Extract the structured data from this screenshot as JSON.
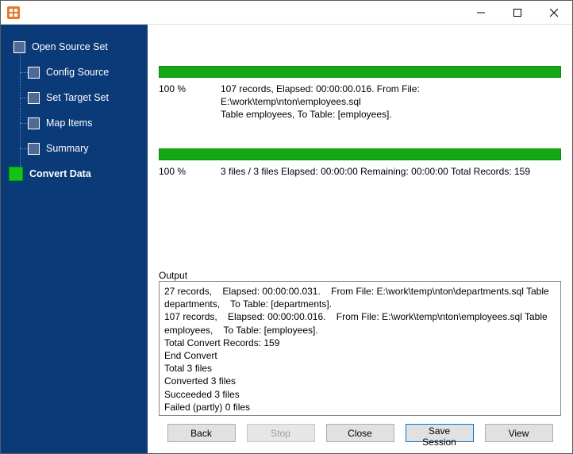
{
  "sidebar": {
    "root": "Open Source Set",
    "items": [
      "Config Source",
      "Set Target Set",
      "Map Items",
      "Summary"
    ],
    "active": "Convert Data"
  },
  "progress1": {
    "pct": "100 %",
    "line1": "107 records,    Elapsed: 00:00:00.016.    From File: E:\\work\\temp\\nton\\employees.sql",
    "line2": "Table employees,    To Table: [employees]."
  },
  "progress2": {
    "pct": "100 %",
    "line": "3 files / 3 files    Elapsed: 00:00:00    Remaining: 00:00:00    Total Records: 159"
  },
  "output_label": "Output",
  "output_text": "27 records,    Elapsed: 00:00:00.031.    From File: E:\\work\\temp\\nton\\departments.sql Table departments,    To Table: [departments].\n107 records,    Elapsed: 00:00:00.016.    From File: E:\\work\\temp\\nton\\employees.sql Table employees,    To Table: [employees].\nTotal Convert Records: 159\nEnd Convert\nTotal 3 files\nConverted 3 files\nSucceeded 3 files\nFailed (partly) 0 files",
  "buttons": {
    "back": "Back",
    "stop": "Stop",
    "close": "Close",
    "save": "Save Session",
    "view": "View"
  }
}
